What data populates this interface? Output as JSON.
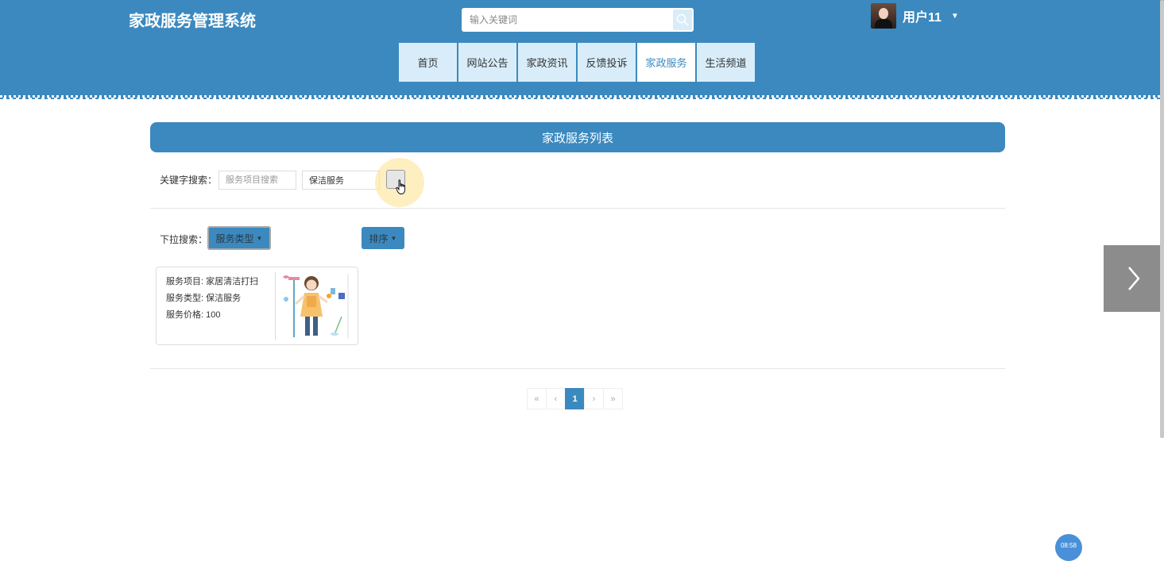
{
  "header": {
    "site_title": "家政服务管理系统",
    "search_placeholder": "输入关键词",
    "user_name": "用户11"
  },
  "nav": {
    "items": [
      "首页",
      "网站公告",
      "家政资讯",
      "反馈投诉",
      "家政服务",
      "生活频道"
    ],
    "active": "家政服务"
  },
  "main": {
    "list_title": "家政服务列表",
    "keyword_label": "关键字搜索：",
    "keyword_placeholder": "服务项目搜索",
    "keyword_value2": "保洁服务",
    "dropdown_label": "下拉搜索：",
    "dropdown_type": "服务类型",
    "dropdown_sort": "排序"
  },
  "cards": [
    {
      "item_line": "服务项目: 家居清洁打扫",
      "type_line": "服务类型: 保洁服务",
      "price_line": "服务价格: 100"
    }
  ],
  "pagination": {
    "first": "«",
    "prev": "‹",
    "current": "1",
    "next": "›",
    "last": "»"
  },
  "float_time": "08:58",
  "colors": {
    "primary": "#3b89bf",
    "nav_bg": "#d8edf9"
  }
}
